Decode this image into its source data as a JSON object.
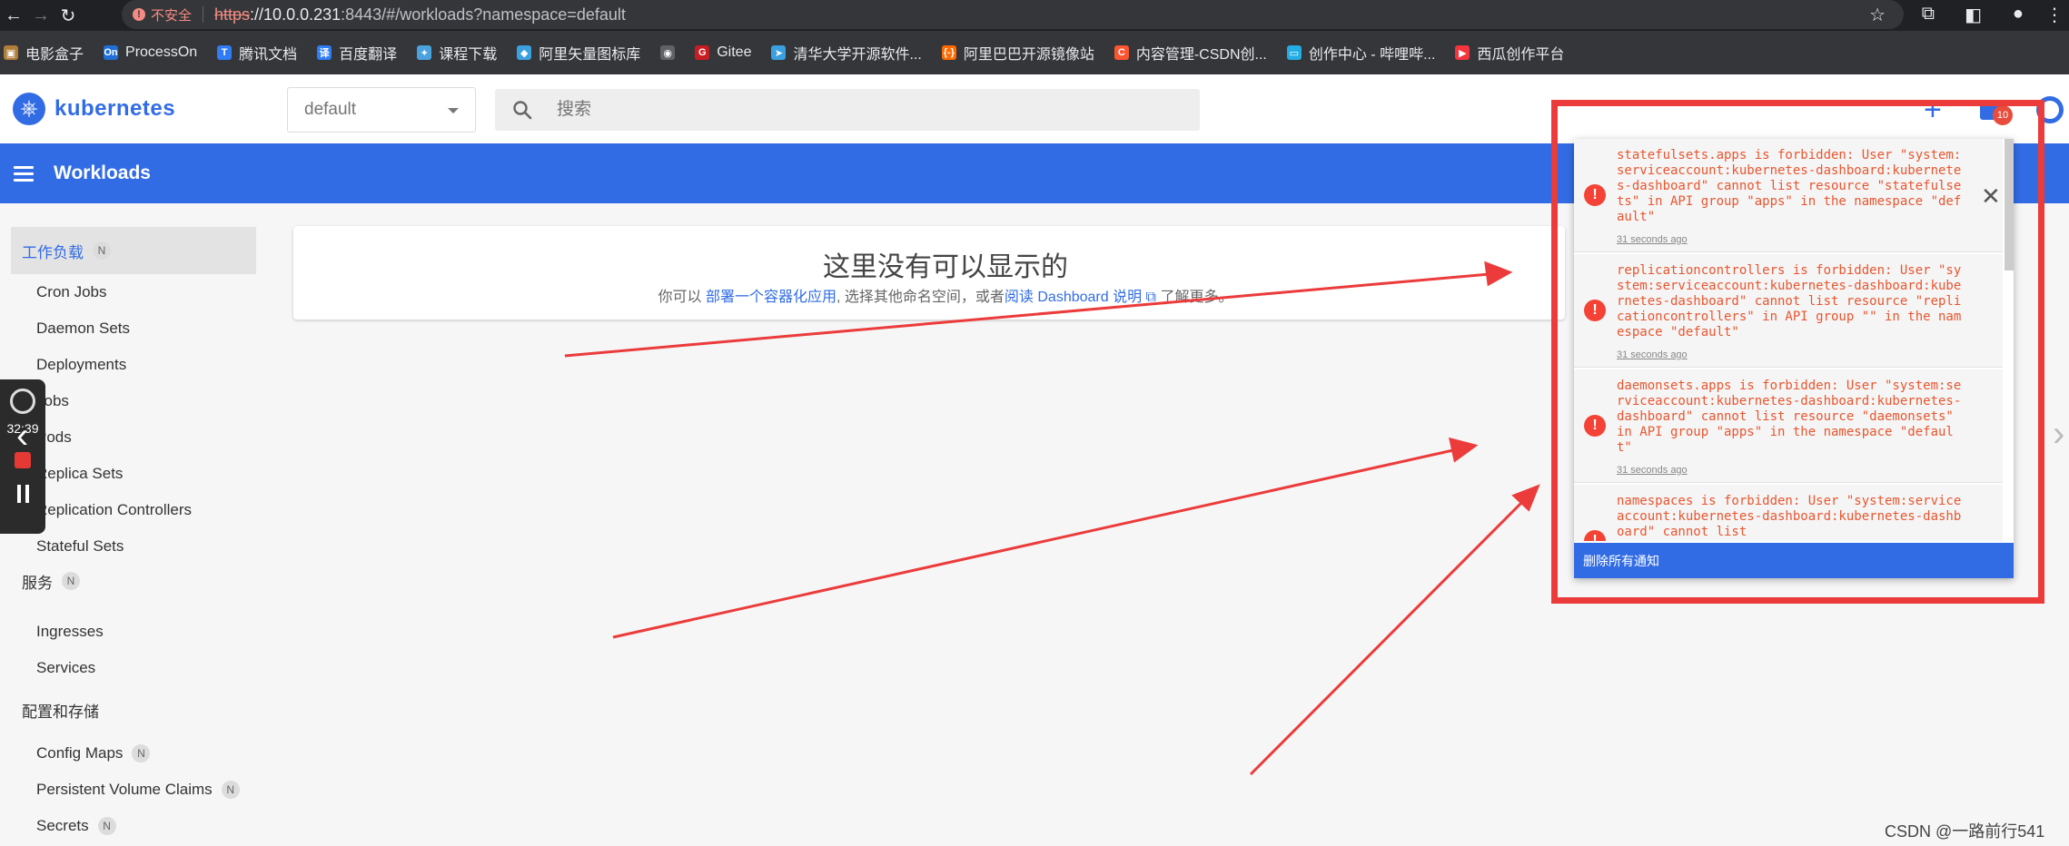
{
  "browser": {
    "insecure_label": "不安全",
    "url_scheme": "https",
    "url_host": "://10.0.0.231",
    "url_rest": ":8443/#/workloads?namespace=default",
    "bookmarks": [
      {
        "label": "电影盒子",
        "icon": "film-icon",
        "color": "#b07d3a",
        "glyph": "▣"
      },
      {
        "label": "ProcessOn",
        "icon": "processon-icon",
        "color": "#1f6fd6",
        "glyph": "On"
      },
      {
        "label": "腾讯文档",
        "icon": "tencent-docs-icon",
        "color": "#2f7cf6",
        "glyph": "T"
      },
      {
        "label": "百度翻译",
        "icon": "baidu-translate-icon",
        "color": "#2f7cf6",
        "glyph": "译"
      },
      {
        "label": "课程下载",
        "icon": "course-icon",
        "color": "#4aa3df",
        "glyph": "✦"
      },
      {
        "label": "阿里矢量图标库",
        "icon": "iconfont-icon",
        "color": "#3aa0e0",
        "glyph": "◆"
      },
      {
        "label": "",
        "icon": "globe-icon",
        "color": "#5f6368",
        "glyph": "◉"
      },
      {
        "label": "Gitee",
        "icon": "gitee-icon",
        "color": "#c71d23",
        "glyph": "G"
      },
      {
        "label": "清华大学开源软件...",
        "icon": "tsinghua-icon",
        "color": "#3aa0e0",
        "glyph": "➤"
      },
      {
        "label": "阿里巴巴开源镜像站",
        "icon": "aliyun-icon",
        "color": "#ff6a00",
        "glyph": "{-}"
      },
      {
        "label": "内容管理-CSDN创...",
        "icon": "csdn-icon",
        "color": "#fc5531",
        "glyph": "C"
      },
      {
        "label": "创作中心 - 哔哩哔...",
        "icon": "bilibili-icon",
        "color": "#23ade5",
        "glyph": "▭"
      },
      {
        "label": "西瓜创作平台",
        "icon": "xigua-icon",
        "color": "#f5343e",
        "glyph": "▶"
      }
    ]
  },
  "header": {
    "logo_text": "kubernetes",
    "namespace": "default",
    "search_placeholder": "搜索",
    "notification_count": "10",
    "title": "Workloads"
  },
  "sidebar": {
    "categories": [
      {
        "label": "工作负载",
        "badge": "N"
      },
      {
        "label": "服务",
        "badge": "N"
      },
      {
        "label": "配置和存储",
        "badge": ""
      }
    ],
    "workload_items": [
      "Cron Jobs",
      "Daemon Sets",
      "Deployments",
      "Jobs",
      "Pods",
      "Replica Sets",
      "Replication Controllers",
      "Stateful Sets"
    ],
    "service_items": [
      "Ingresses",
      "Services"
    ],
    "config_items": [
      {
        "label": "Config Maps",
        "badge": "N"
      },
      {
        "label": "Persistent Volume Claims",
        "badge": "N"
      },
      {
        "label": "Secrets",
        "badge": "N"
      }
    ]
  },
  "recorder": {
    "time": "32:39"
  },
  "main": {
    "empty_title": "这里没有可以显示的",
    "empty_desc_prefix": "你可以",
    "empty_desc_link1": "部署一个容器化应用",
    "empty_desc_mid": ", 选择其他命名空间，或者",
    "empty_desc_link2": "阅读 Dashboard 说明",
    "empty_desc_suffix": "了解更多。"
  },
  "notifications": {
    "items": [
      {
        "message": "statefulsets.apps is forbidden: User \"system:serviceaccount:kubernetes-dashboard:kubernetes-dashboard\" cannot list resource \"statefulsets\" in API group \"apps\" in the namespace \"default\"",
        "time": "31 seconds ago"
      },
      {
        "message": "replicationcontrollers is forbidden: User \"system:serviceaccount:kubernetes-dashboard:kubernetes-dashboard\" cannot list resource \"replicationcontrollers\" in API group \"\" in the namespace \"default\"",
        "time": "31 seconds ago"
      },
      {
        "message": "daemonsets.apps is forbidden: User \"system:serviceaccount:kubernetes-dashboard:kubernetes-dashboard\" cannot list resource \"daemonsets\" in API group \"apps\" in the namespace \"default\"",
        "time": "31 seconds ago"
      },
      {
        "message": "namespaces is forbidden: User \"system:serviceaccount:kubernetes-dashboard:kubernetes-dashboard\" cannot list",
        "time": ""
      }
    ],
    "clear_all_label": "删除所有通知"
  },
  "watermark": "CSDN @一路前行541",
  "colors": {
    "k8s_blue": "#326ce5",
    "error_red": "#f44336",
    "annotation_red": "#ec3b3b"
  }
}
